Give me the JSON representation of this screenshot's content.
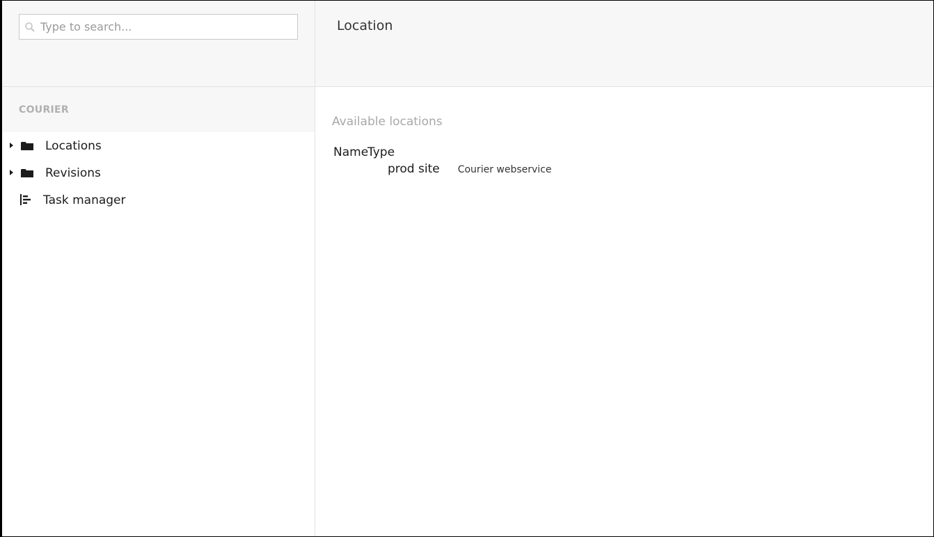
{
  "search": {
    "placeholder": "Type to search..."
  },
  "sidebar": {
    "section_title": "COURIER",
    "items": [
      {
        "label": "Locations",
        "icon": "folder-icon",
        "expandable": true
      },
      {
        "label": "Revisions",
        "icon": "folder-icon",
        "expandable": true
      },
      {
        "label": "Task manager",
        "icon": "task-list-icon",
        "expandable": false
      }
    ]
  },
  "main": {
    "title": "Location",
    "subtitle": "Available locations",
    "table": {
      "headers": {
        "name": "Name",
        "type": "Type"
      },
      "rows": [
        {
          "name": "prod site",
          "type": "Courier webservice"
        }
      ]
    }
  },
  "colors": {
    "header_bg": "#f7f7f7",
    "border": "#e1e1e1",
    "muted_text": "#a8a8a8"
  }
}
